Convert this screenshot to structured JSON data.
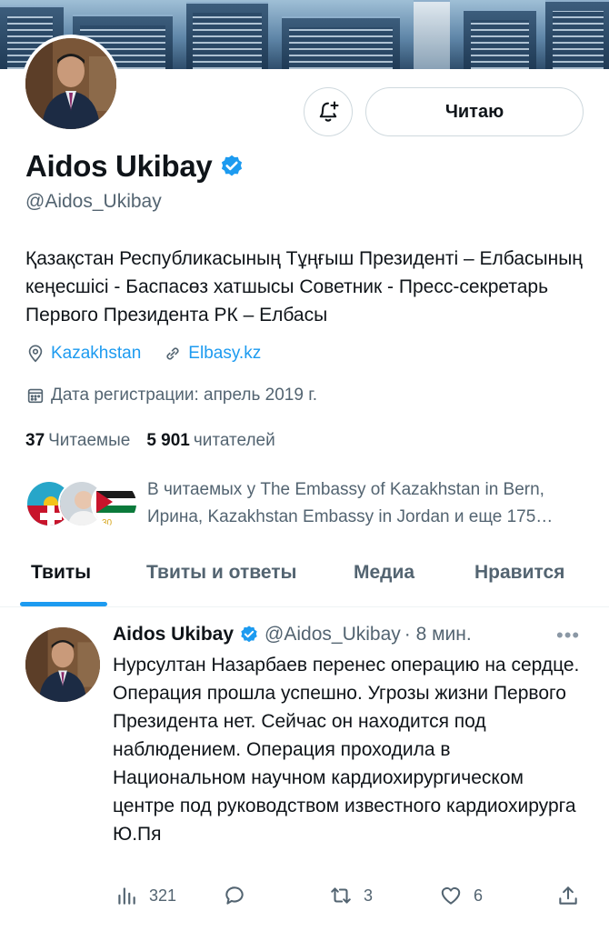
{
  "profile": {
    "name": "Aidos Ukibay",
    "handle": "@Aidos_Ukibay",
    "bio": "Қазақстан Республикасының Тұңғыш Президенті – Елбасының кеңесшісі - Баспасөз хатшысы Советник - Пресс-секретарь Первого Президента РК – Елбасы",
    "location": "Kazakhstan",
    "website": "Elbasy.kz",
    "joined": "Дата регистрации: апрель 2019 г.",
    "following_count": "37",
    "following_label": "Читаемые",
    "followers_count": "5 901",
    "followers_label": "читателей",
    "followed_by": "В читаемых у The Embassy of Kazakhstan in Bern, Ирина, Kazakhstan Embassy in Jordan и еще 175…"
  },
  "buttons": {
    "follow_label": "Читаю",
    "notifications_icon": "bell-plus-icon"
  },
  "tabs": [
    {
      "label": "Твиты",
      "active": true
    },
    {
      "label": "Твиты и ответы",
      "active": false
    },
    {
      "label": "Медиа",
      "active": false
    },
    {
      "label": "Нравится",
      "active": false
    }
  ],
  "tweet": {
    "name": "Aidos Ukibay",
    "handle": "@Aidos_Ukibay",
    "time": "· 8 мин.",
    "text": "Нурсултан Назарбаев перенес операцию на сердце. Операция прошла успешно. Угрозы жизни Первого Президента нет. Сейчас он находится под наблюдением. Операция проходила в Национальном научном кардиохирургическом центре под руководством известного кардиохирурга Ю.Пя",
    "views": "321",
    "retweets": "3",
    "likes": "6"
  },
  "colors": {
    "accent": "#1d9bf0",
    "text": "#0f1419",
    "secondary": "#536471"
  }
}
